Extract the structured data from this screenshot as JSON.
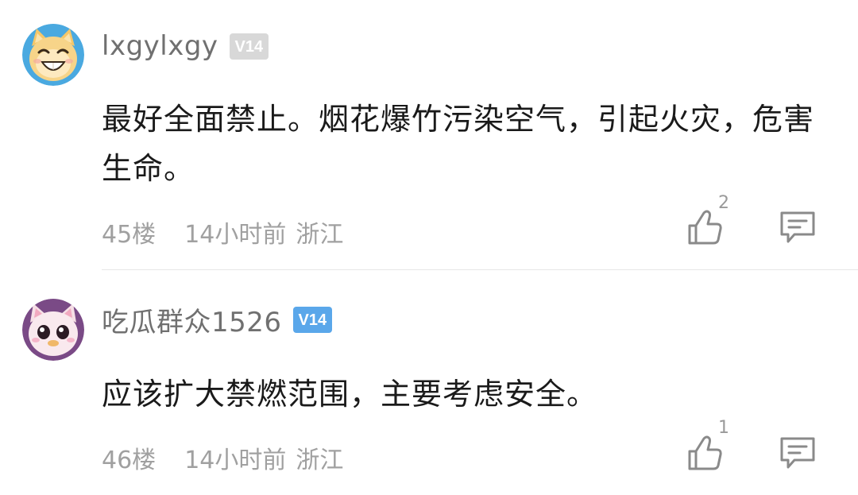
{
  "comments": [
    {
      "username": "lxgylxgy",
      "level": "V14",
      "content": "最好全面禁止。烟花爆竹污染空气，引起火灾，危害生命。",
      "floor": "45楼",
      "time": "14小时前",
      "location": "浙江",
      "likes": "2",
      "avatar_icon": "smiling-cat-avatar-icon",
      "badge_color": "#d8d8d8"
    },
    {
      "username": "吃瓜群众1526",
      "level": "V14",
      "content": "应该扩大禁燃范围，主要考虑安全。",
      "floor": "46楼",
      "time": "14小时前",
      "location": "浙江",
      "likes": "1",
      "avatar_icon": "pink-cat-avatar-icon",
      "badge_color": "#5aa7ea"
    }
  ]
}
